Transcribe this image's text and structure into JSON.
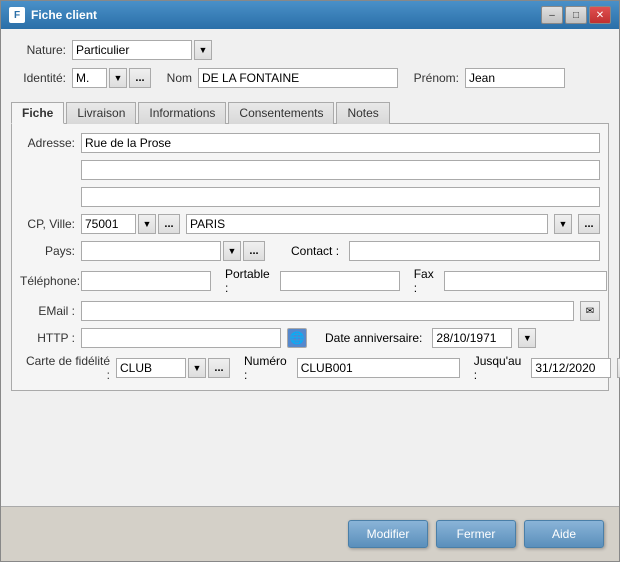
{
  "window": {
    "title": "Fiche client"
  },
  "titleButtons": {
    "minimize": "–",
    "restore": "□",
    "close": "✕"
  },
  "form": {
    "natureLabel": "Nature:",
    "natureValue": "Particulier",
    "identiteLabel": "Identité:",
    "civiliteValue": "M.",
    "nomLabel": "Nom",
    "nomValue": "DE LA FONTAINE",
    "prenomLabel": "Prénom:",
    "prenomValue": "Jean"
  },
  "tabs": [
    {
      "label": "Fiche",
      "active": true
    },
    {
      "label": "Livraison",
      "active": false
    },
    {
      "label": "Informations",
      "active": false
    },
    {
      "label": "Consentements",
      "active": false
    },
    {
      "label": "Notes",
      "active": false
    }
  ],
  "ficheTab": {
    "adresseLabel": "Adresse:",
    "adresseValue": "Rue de la Prose",
    "adresseLine2": "",
    "adresseLine3": "",
    "cpLabel": "CP, Ville:",
    "cpValue": "75001",
    "villeValue": "PARIS",
    "paysLabel": "Pays:",
    "contactLabel": "Contact :",
    "contactValue": "",
    "telephoneLabel": "Téléphone:",
    "telephoneValue": "",
    "portableLabel": "Portable :",
    "portableValue": "",
    "faxLabel": "Fax :",
    "faxValue": "",
    "emailLabel": "EMail :",
    "emailValue": "",
    "httpLabel": "HTTP :",
    "httpValue": "",
    "dateAnnivLabel": "Date anniversaire:",
    "dateAnnivValue": "28/10/1971",
    "carteLabel": "Carte de fidélité :",
    "carteValue": "CLUB",
    "numeroLabel": "Numéro :",
    "numeroValue": "CLUB001",
    "jusquauLabel": "Jusqu'au :",
    "jusquauValue": "31/12/2020"
  },
  "footer": {
    "modifierLabel": "Modifier",
    "fermerLabel": "Fermer",
    "aideLabel": "Aide"
  }
}
